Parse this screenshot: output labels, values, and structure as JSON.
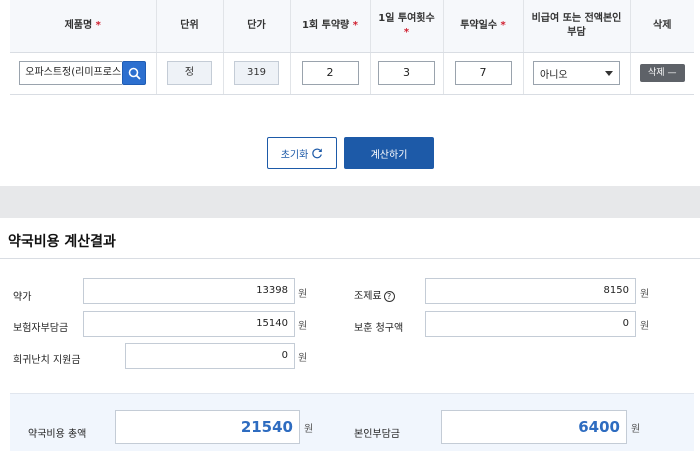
{
  "entry_table": {
    "headers": {
      "product": "제품명",
      "unit": "단위",
      "price": "단가",
      "dose": "1회 투약량",
      "freq": "1일 투여횟수",
      "days": "투약일수",
      "nonpay": "비급여 또는 전액본인부담",
      "delete": "삭제"
    },
    "required_mark": "*",
    "row": {
      "product": "오파스트정(리미프로스",
      "unit": "정",
      "price": "319",
      "dose": "2",
      "freq": "3",
      "days": "7",
      "nonpay": "아니오",
      "delete": "삭제 —"
    }
  },
  "buttons": {
    "reset": "초기화",
    "calculate": "계산하기"
  },
  "result": {
    "title": "약국비용 계산결과",
    "currency": "원",
    "fields": {
      "drug_cost": {
        "label": "약가",
        "value": "13398"
      },
      "dispensing_fee": {
        "label": "조제료",
        "value": "8150"
      },
      "insurer_share": {
        "label": "보험자부담금",
        "value": "15140"
      },
      "veterans_claim": {
        "label": "보훈 청구액",
        "value": "0"
      },
      "rare_support": {
        "label": "희귀난치 지원금",
        "value": "0"
      }
    },
    "totals": {
      "total_cost": {
        "label": "약국비용 총액",
        "value": "21540"
      },
      "patient_share": {
        "label": "본인부담금",
        "value": "6400"
      }
    }
  },
  "colors": {
    "accent": "#1d5aa8",
    "required": "#d02030",
    "total_value": "#2e6cc0"
  }
}
